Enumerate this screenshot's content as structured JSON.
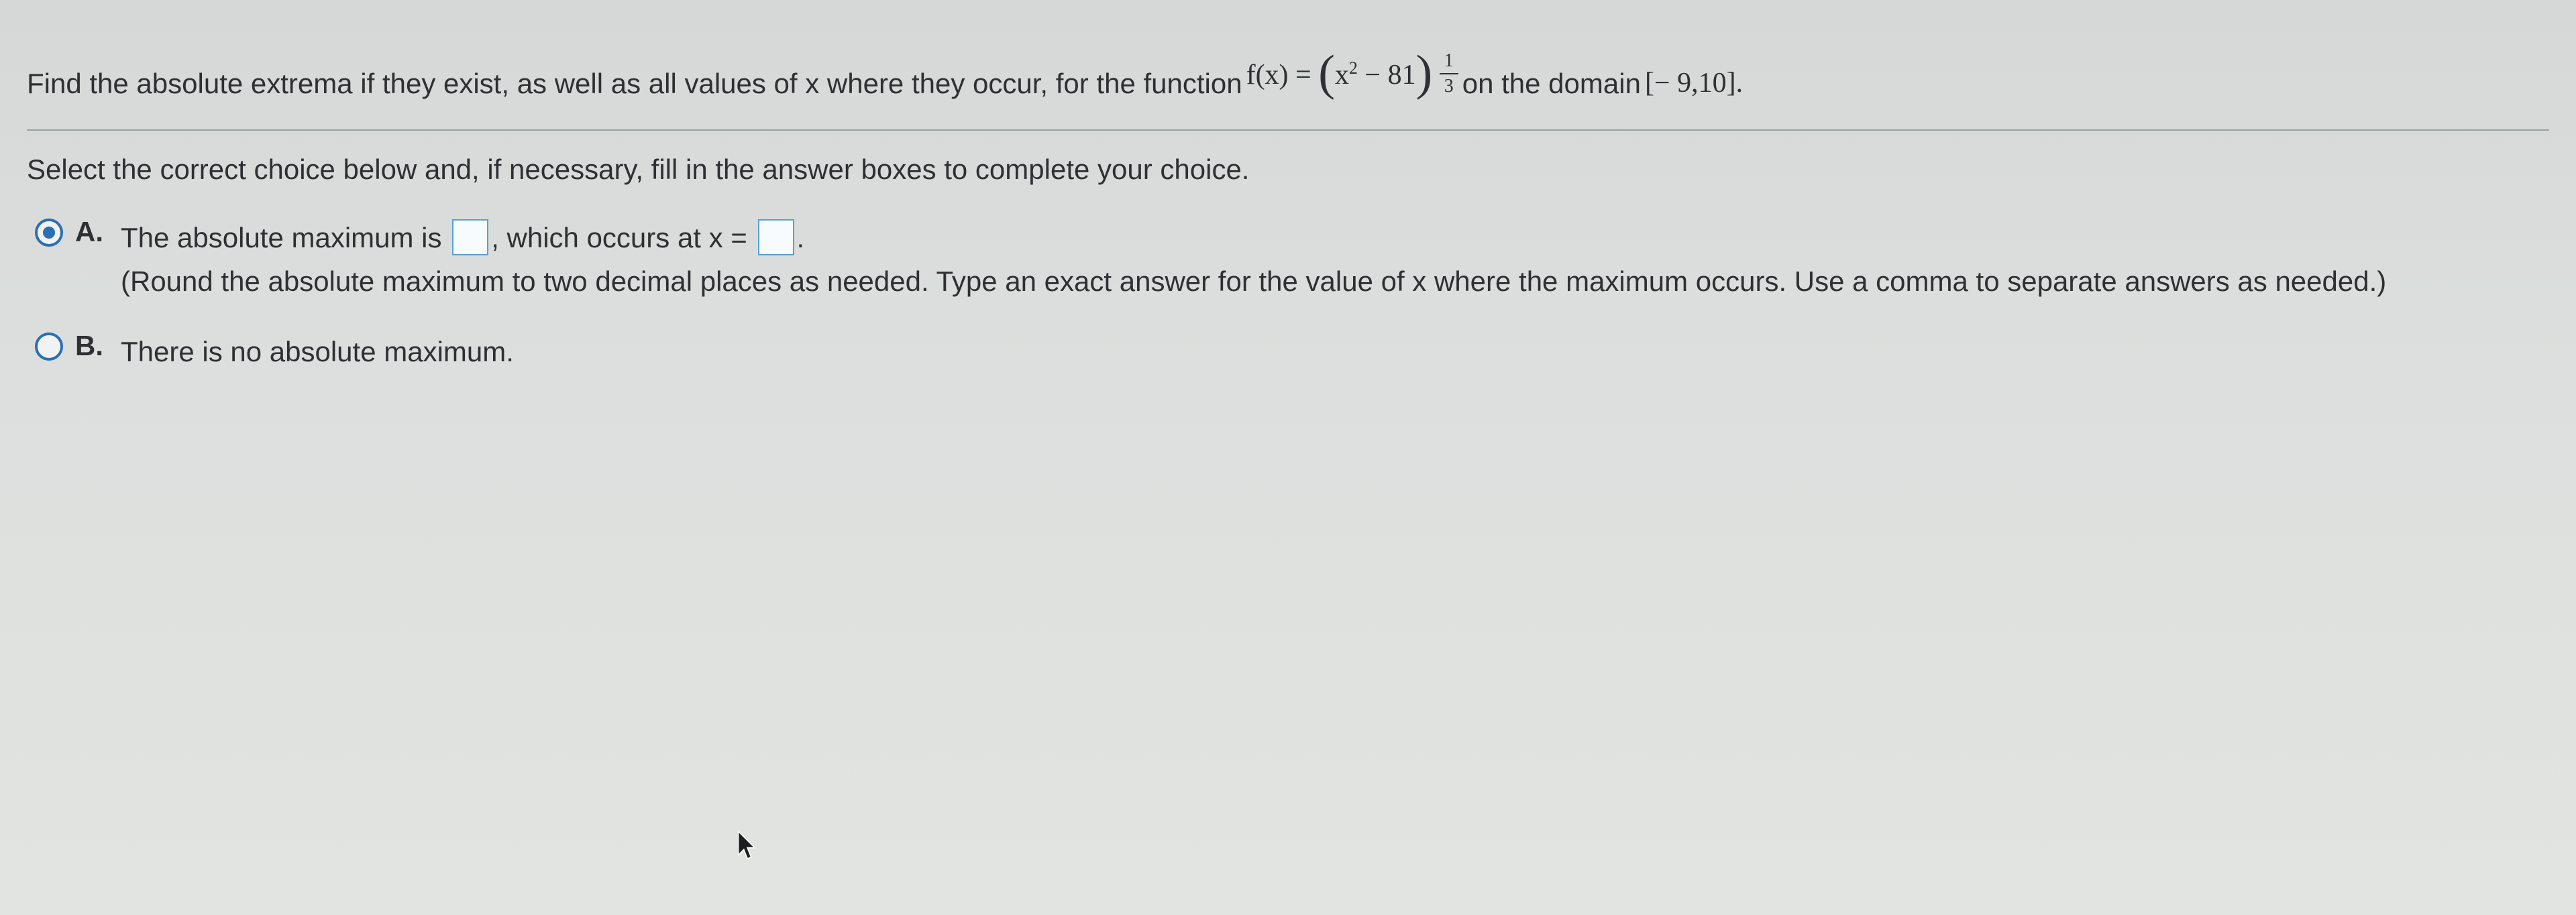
{
  "header": {
    "help_fragment": ""
  },
  "question": {
    "prompt_part1": "Find the absolute extrema if they exist, as well as all values of x where they occur, for the function",
    "fx_prefix": "f(x) = ",
    "exp_num": "1",
    "exp_den": "3",
    "prompt_part2": " on the domain ",
    "domain": "[− 9,10].",
    "instruction": "Select the correct choice below and, if necessary, fill in the answer boxes to complete your choice."
  },
  "choices": [
    {
      "label": "A.",
      "selected": true,
      "text1": "The absolute maximum is ",
      "text2": ", which occurs at x = ",
      "hint": "(Round the absolute maximum to two decimal places as needed. Type an exact answer for the value of x where the maximum occurs. Use a comma to separate answers as needed.)"
    },
    {
      "label": "B.",
      "selected": false,
      "text": "There is no absolute maximum."
    }
  ]
}
